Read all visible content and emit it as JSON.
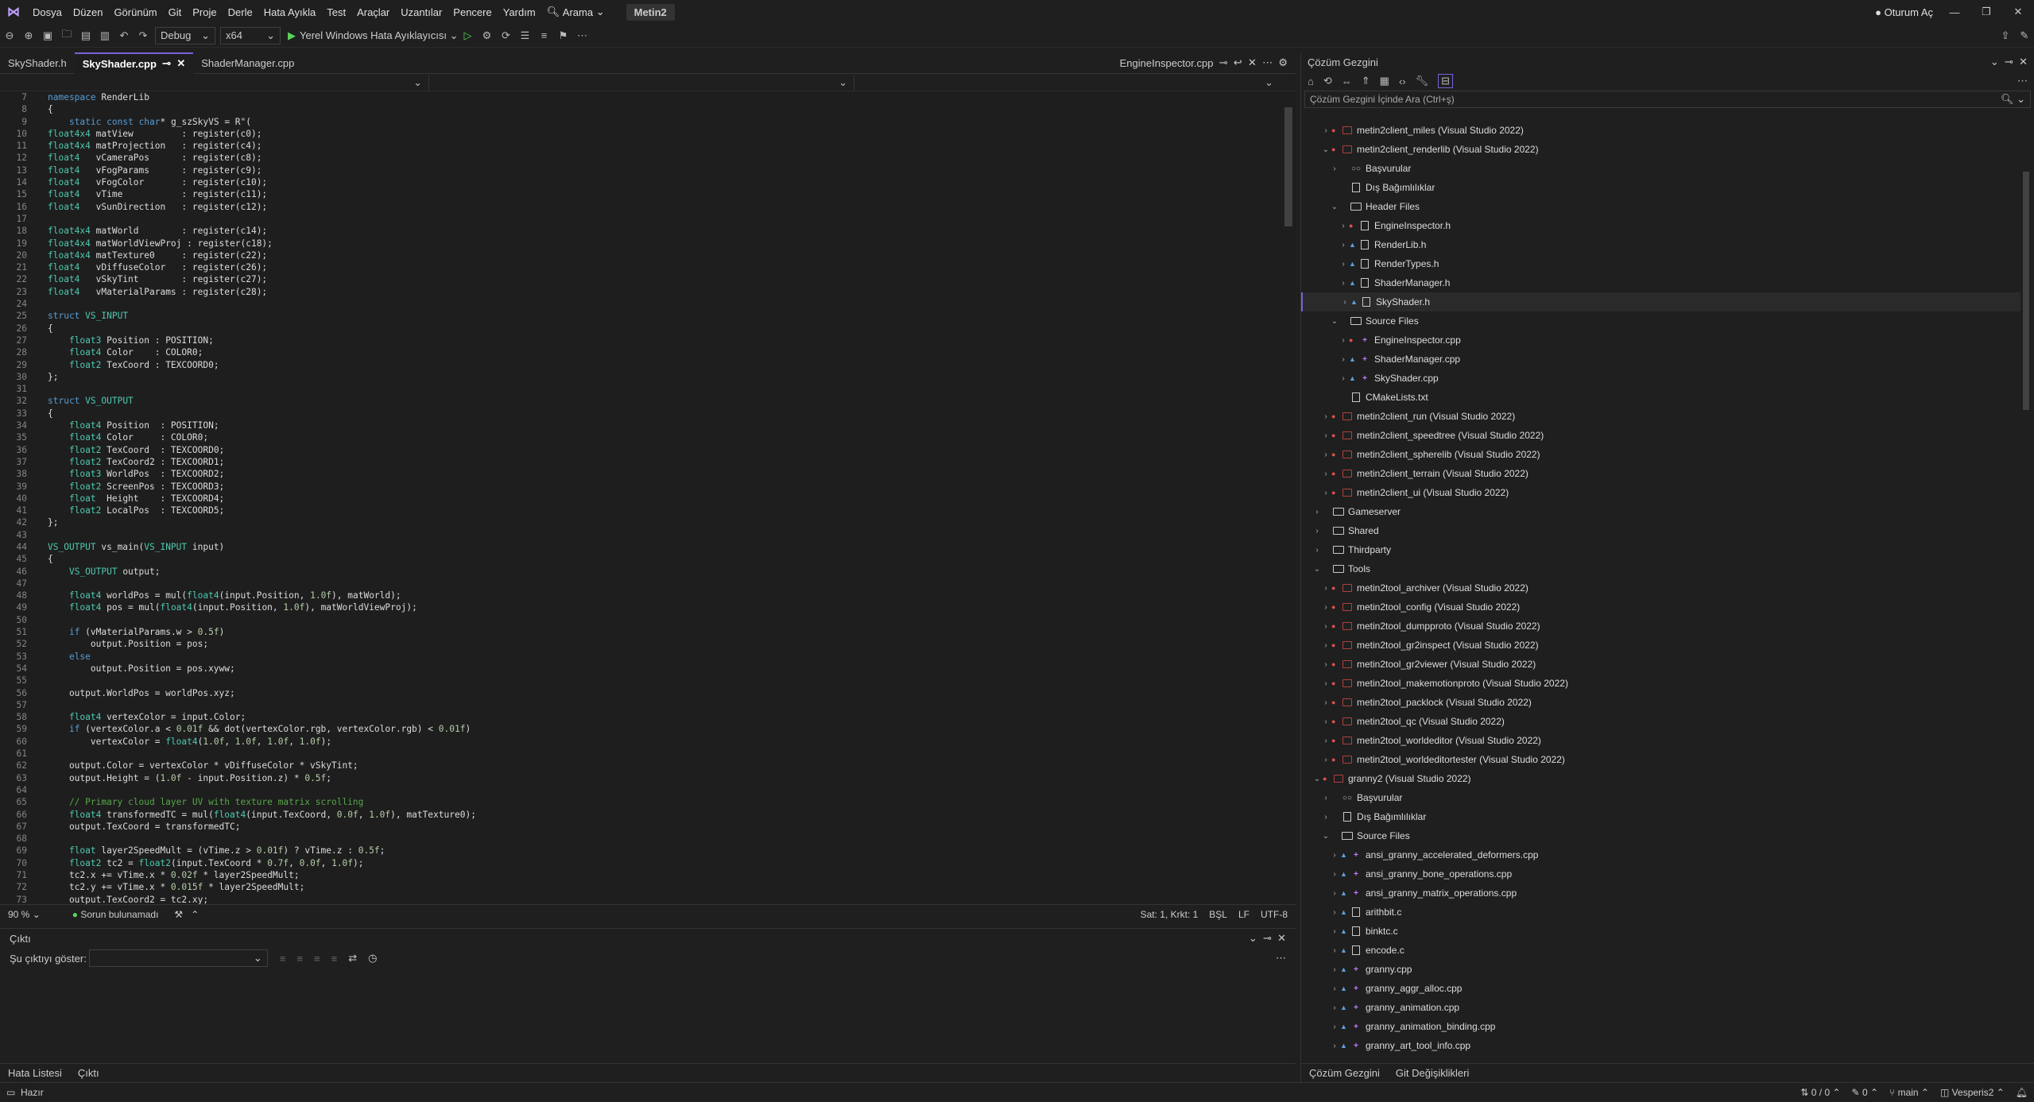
{
  "menu": [
    "Dosya",
    "Düzen",
    "Görünüm",
    "Git",
    "Proje",
    "Derle",
    "Hata Ayıkla",
    "Test",
    "Araçlar",
    "Uzantılar",
    "Pencere",
    "Yardım"
  ],
  "search_label": "Arama",
  "solution_name": "Metin2",
  "signin": "Oturum Aç",
  "toolbar": {
    "config": "Debug",
    "platform": "x64",
    "run_label": "Yerel Windows Hata Ayıklayıcısı"
  },
  "tabs": [
    {
      "label": "SkyShader.h",
      "active": false
    },
    {
      "label": "SkyShader.cpp",
      "active": true
    },
    {
      "label": "ShaderManager.cpp",
      "active": false
    }
  ],
  "right_tab": "EngineInspector.cpp",
  "code": [
    {
      "n": "7",
      "t": "namespace RenderLib"
    },
    {
      "n": "8",
      "t": "{"
    },
    {
      "n": "9",
      "t": "    static const char* g_szSkyVS = R\"("
    },
    {
      "n": "10",
      "t": "float4x4 matView         : register(c0);"
    },
    {
      "n": "11",
      "t": "float4x4 matProjection   : register(c4);"
    },
    {
      "n": "12",
      "t": "float4   vCameraPos      : register(c8);"
    },
    {
      "n": "13",
      "t": "float4   vFogParams      : register(c9);"
    },
    {
      "n": "14",
      "t": "float4   vFogColor       : register(c10);"
    },
    {
      "n": "15",
      "t": "float4   vTime           : register(c11);"
    },
    {
      "n": "16",
      "t": "float4   vSunDirection   : register(c12);"
    },
    {
      "n": "17",
      "t": ""
    },
    {
      "n": "18",
      "t": "float4x4 matWorld        : register(c14);"
    },
    {
      "n": "19",
      "t": "float4x4 matWorldViewProj : register(c18);"
    },
    {
      "n": "20",
      "t": "float4x4 matTexture0     : register(c22);"
    },
    {
      "n": "21",
      "t": "float4   vDiffuseColor   : register(c26);"
    },
    {
      "n": "22",
      "t": "float4   vSkyTint        : register(c27);"
    },
    {
      "n": "23",
      "t": "float4   vMaterialParams : register(c28);"
    },
    {
      "n": "24",
      "t": ""
    },
    {
      "n": "25",
      "t": "struct VS_INPUT"
    },
    {
      "n": "26",
      "t": "{"
    },
    {
      "n": "27",
      "t": "    float3 Position : POSITION;"
    },
    {
      "n": "28",
      "t": "    float4 Color    : COLOR0;"
    },
    {
      "n": "29",
      "t": "    float2 TexCoord : TEXCOORD0;"
    },
    {
      "n": "30",
      "t": "};"
    },
    {
      "n": "31",
      "t": ""
    },
    {
      "n": "32",
      "t": "struct VS_OUTPUT"
    },
    {
      "n": "33",
      "t": "{"
    },
    {
      "n": "34",
      "t": "    float4 Position  : POSITION;"
    },
    {
      "n": "35",
      "t": "    float4 Color     : COLOR0;"
    },
    {
      "n": "36",
      "t": "    float2 TexCoord  : TEXCOORD0;"
    },
    {
      "n": "37",
      "t": "    float2 TexCoord2 : TEXCOORD1;"
    },
    {
      "n": "38",
      "t": "    float3 WorldPos  : TEXCOORD2;"
    },
    {
      "n": "39",
      "t": "    float2 ScreenPos : TEXCOORD3;"
    },
    {
      "n": "40",
      "t": "    float  Height    : TEXCOORD4;"
    },
    {
      "n": "41",
      "t": "    float2 LocalPos  : TEXCOORD5;"
    },
    {
      "n": "42",
      "t": "};"
    },
    {
      "n": "43",
      "t": ""
    },
    {
      "n": "44",
      "t": "VS_OUTPUT vs_main(VS_INPUT input)"
    },
    {
      "n": "45",
      "t": "{"
    },
    {
      "n": "46",
      "t": "    VS_OUTPUT output;"
    },
    {
      "n": "47",
      "t": ""
    },
    {
      "n": "48",
      "t": "    float4 worldPos = mul(float4(input.Position, 1.0f), matWorld);"
    },
    {
      "n": "49",
      "t": "    float4 pos = mul(float4(input.Position, 1.0f), matWorldViewProj);"
    },
    {
      "n": "50",
      "t": ""
    },
    {
      "n": "51",
      "t": "    if (vMaterialParams.w > 0.5f)"
    },
    {
      "n": "52",
      "t": "        output.Position = pos;"
    },
    {
      "n": "53",
      "t": "    else"
    },
    {
      "n": "54",
      "t": "        output.Position = pos.xyww;"
    },
    {
      "n": "55",
      "t": ""
    },
    {
      "n": "56",
      "t": "    output.WorldPos = worldPos.xyz;"
    },
    {
      "n": "57",
      "t": ""
    },
    {
      "n": "58",
      "t": "    float4 vertexColor = input.Color;"
    },
    {
      "n": "59",
      "t": "    if (vertexColor.a < 0.01f && dot(vertexColor.rgb, vertexColor.rgb) < 0.01f)"
    },
    {
      "n": "60",
      "t": "        vertexColor = float4(1.0f, 1.0f, 1.0f, 1.0f);"
    },
    {
      "n": "61",
      "t": ""
    },
    {
      "n": "62",
      "t": "    output.Color = vertexColor * vDiffuseColor * vSkyTint;"
    },
    {
      "n": "63",
      "t": "    output.Height = (1.0f - input.Position.z) * 0.5f;"
    },
    {
      "n": "64",
      "t": ""
    },
    {
      "n": "65",
      "t": "    // Primary cloud layer UV with texture matrix scrolling"
    },
    {
      "n": "66",
      "t": "    float4 transformedTC = mul(float4(input.TexCoord, 0.0f, 1.0f), matTexture0);"
    },
    {
      "n": "67",
      "t": "    output.TexCoord = transformedTC;"
    },
    {
      "n": "68",
      "t": ""
    },
    {
      "n": "69",
      "t": "    float layer2SpeedMult = (vTime.z > 0.01f) ? vTime.z : 0.5f;"
    },
    {
      "n": "70",
      "t": "    float2 tc2 = float2(input.TexCoord * 0.7f, 0.0f, 1.0f);"
    },
    {
      "n": "71",
      "t": "    tc2.x += vTime.x * 0.02f * layer2SpeedMult;"
    },
    {
      "n": "72",
      "t": "    tc2.y += vTime.x * 0.015f * layer2SpeedMult;"
    },
    {
      "n": "73",
      "t": "    output.TexCoord2 = tc2.xy;"
    }
  ],
  "status_editor": {
    "zoom": "90 %",
    "issues": "Sorun bulunamadı",
    "position": "Sat: 1, Krkt: 1",
    "mode": "BŞL",
    "eol": "LF",
    "encoding": "UTF-8"
  },
  "output": {
    "title": "Çıktı",
    "show_label": "Şu çıktıyı göster:"
  },
  "bottom_tabs": [
    "Hata Listesi",
    "Çıktı"
  ],
  "solution_explorer": {
    "title": "Çözüm Gezgini",
    "search_placeholder": "Çözüm Gezgini İçinde Ara (Ctrl+ş)",
    "bottom_tabs": [
      "Çözüm Gezgini",
      "Git Değişiklikleri"
    ]
  },
  "tree": [
    {
      "d": 2,
      "k": "proj",
      "t": "metin2client_miles (Visual Studio 2022)",
      "e": ">"
    },
    {
      "d": 2,
      "k": "proj",
      "t": "metin2client_renderlib (Visual Studio 2022)",
      "e": "v"
    },
    {
      "d": 3,
      "k": "ref",
      "t": "Başvurular",
      "e": ">"
    },
    {
      "d": 3,
      "k": "dep",
      "t": "Dış Bağımlılıklar",
      "e": ""
    },
    {
      "d": 3,
      "k": "fold",
      "t": "Header Files",
      "e": "v"
    },
    {
      "d": 4,
      "k": "h",
      "t": "EngineInspector.h",
      "e": ">",
      "i": "r"
    },
    {
      "d": 4,
      "k": "h",
      "t": "RenderLib.h",
      "e": ">",
      "i": "b"
    },
    {
      "d": 4,
      "k": "h",
      "t": "RenderTypes.h",
      "e": ">",
      "i": "b"
    },
    {
      "d": 4,
      "k": "h",
      "t": "ShaderManager.h",
      "e": ">",
      "i": "b"
    },
    {
      "d": 4,
      "k": "h",
      "t": "SkyShader.h",
      "e": ">",
      "i": "b",
      "sel": true
    },
    {
      "d": 3,
      "k": "fold",
      "t": "Source Files",
      "e": "v"
    },
    {
      "d": 4,
      "k": "cpp",
      "t": "EngineInspector.cpp",
      "e": ">",
      "i": "r"
    },
    {
      "d": 4,
      "k": "cpp",
      "t": "ShaderManager.cpp",
      "e": ">",
      "i": "b"
    },
    {
      "d": 4,
      "k": "cpp",
      "t": "SkyShader.cpp",
      "e": ">",
      "i": "b"
    },
    {
      "d": 3,
      "k": "txt",
      "t": "CMakeLists.txt",
      "e": ""
    },
    {
      "d": 2,
      "k": "proj",
      "t": "metin2client_run (Visual Studio 2022)",
      "e": ">"
    },
    {
      "d": 2,
      "k": "proj",
      "t": "metin2client_speedtree (Visual Studio 2022)",
      "e": ">"
    },
    {
      "d": 2,
      "k": "proj",
      "t": "metin2client_spherelib (Visual Studio 2022)",
      "e": ">"
    },
    {
      "d": 2,
      "k": "proj",
      "t": "metin2client_terrain (Visual Studio 2022)",
      "e": ">"
    },
    {
      "d": 2,
      "k": "proj",
      "t": "metin2client_ui (Visual Studio 2022)",
      "e": ">"
    },
    {
      "d": 1,
      "k": "fold",
      "t": "Gameserver",
      "e": ">"
    },
    {
      "d": 1,
      "k": "fold",
      "t": "Shared",
      "e": ">"
    },
    {
      "d": 1,
      "k": "fold",
      "t": "Thirdparty",
      "e": ">"
    },
    {
      "d": 1,
      "k": "fold",
      "t": "Tools",
      "e": "v"
    },
    {
      "d": 2,
      "k": "proj",
      "t": "metin2tool_archiver (Visual Studio 2022)",
      "e": ">"
    },
    {
      "d": 2,
      "k": "proj",
      "t": "metin2tool_config (Visual Studio 2022)",
      "e": ">"
    },
    {
      "d": 2,
      "k": "proj",
      "t": "metin2tool_dumpproto (Visual Studio 2022)",
      "e": ">"
    },
    {
      "d": 2,
      "k": "proj",
      "t": "metin2tool_gr2inspect (Visual Studio 2022)",
      "e": ">"
    },
    {
      "d": 2,
      "k": "proj",
      "t": "metin2tool_gr2viewer (Visual Studio 2022)",
      "e": ">"
    },
    {
      "d": 2,
      "k": "proj",
      "t": "metin2tool_makemotionproto (Visual Studio 2022)",
      "e": ">"
    },
    {
      "d": 2,
      "k": "proj",
      "t": "metin2tool_packlock (Visual Studio 2022)",
      "e": ">"
    },
    {
      "d": 2,
      "k": "proj",
      "t": "metin2tool_qc (Visual Studio 2022)",
      "e": ">"
    },
    {
      "d": 2,
      "k": "proj",
      "t": "metin2tool_worldeditor (Visual Studio 2022)",
      "e": ">"
    },
    {
      "d": 2,
      "k": "proj",
      "t": "metin2tool_worldeditortester (Visual Studio 2022)",
      "e": ">"
    },
    {
      "d": 1,
      "k": "proj",
      "t": "granny2 (Visual Studio 2022)",
      "e": "v"
    },
    {
      "d": 2,
      "k": "ref",
      "t": "Başvurular",
      "e": ">"
    },
    {
      "d": 2,
      "k": "dep",
      "t": "Dış Bağımlılıklar",
      "e": ">"
    },
    {
      "d": 2,
      "k": "fold",
      "t": "Source Files",
      "e": "v"
    },
    {
      "d": 3,
      "k": "cpp",
      "t": "ansi_granny_accelerated_deformers.cpp",
      "e": ">",
      "i": "b"
    },
    {
      "d": 3,
      "k": "cpp",
      "t": "ansi_granny_bone_operations.cpp",
      "e": ">",
      "i": "b"
    },
    {
      "d": 3,
      "k": "cpp",
      "t": "ansi_granny_matrix_operations.cpp",
      "e": ">",
      "i": "b"
    },
    {
      "d": 3,
      "k": "c",
      "t": "arithbit.c",
      "e": ">",
      "i": "b"
    },
    {
      "d": 3,
      "k": "c",
      "t": "binktc.c",
      "e": ">",
      "i": "b"
    },
    {
      "d": 3,
      "k": "c",
      "t": "encode.c",
      "e": ">",
      "i": "b"
    },
    {
      "d": 3,
      "k": "cpp",
      "t": "granny.cpp",
      "e": ">",
      "i": "b"
    },
    {
      "d": 3,
      "k": "cpp",
      "t": "granny_aggr_alloc.cpp",
      "e": ">",
      "i": "b"
    },
    {
      "d": 3,
      "k": "cpp",
      "t": "granny_animation.cpp",
      "e": ">",
      "i": "b"
    },
    {
      "d": 3,
      "k": "cpp",
      "t": "granny_animation_binding.cpp",
      "e": ">",
      "i": "b"
    },
    {
      "d": 3,
      "k": "cpp",
      "t": "granny_art_tool_info.cpp",
      "e": ">",
      "i": "b"
    }
  ],
  "statusbar": {
    "ready": "Hazır",
    "lines": "0 / 0",
    "changes": "0",
    "branch": "main",
    "repo": "Vesperis2"
  },
  "colors": {
    "accent": "#7b61d6",
    "bg": "#1f1f1f",
    "editor_bg": "#1e1e1e"
  }
}
